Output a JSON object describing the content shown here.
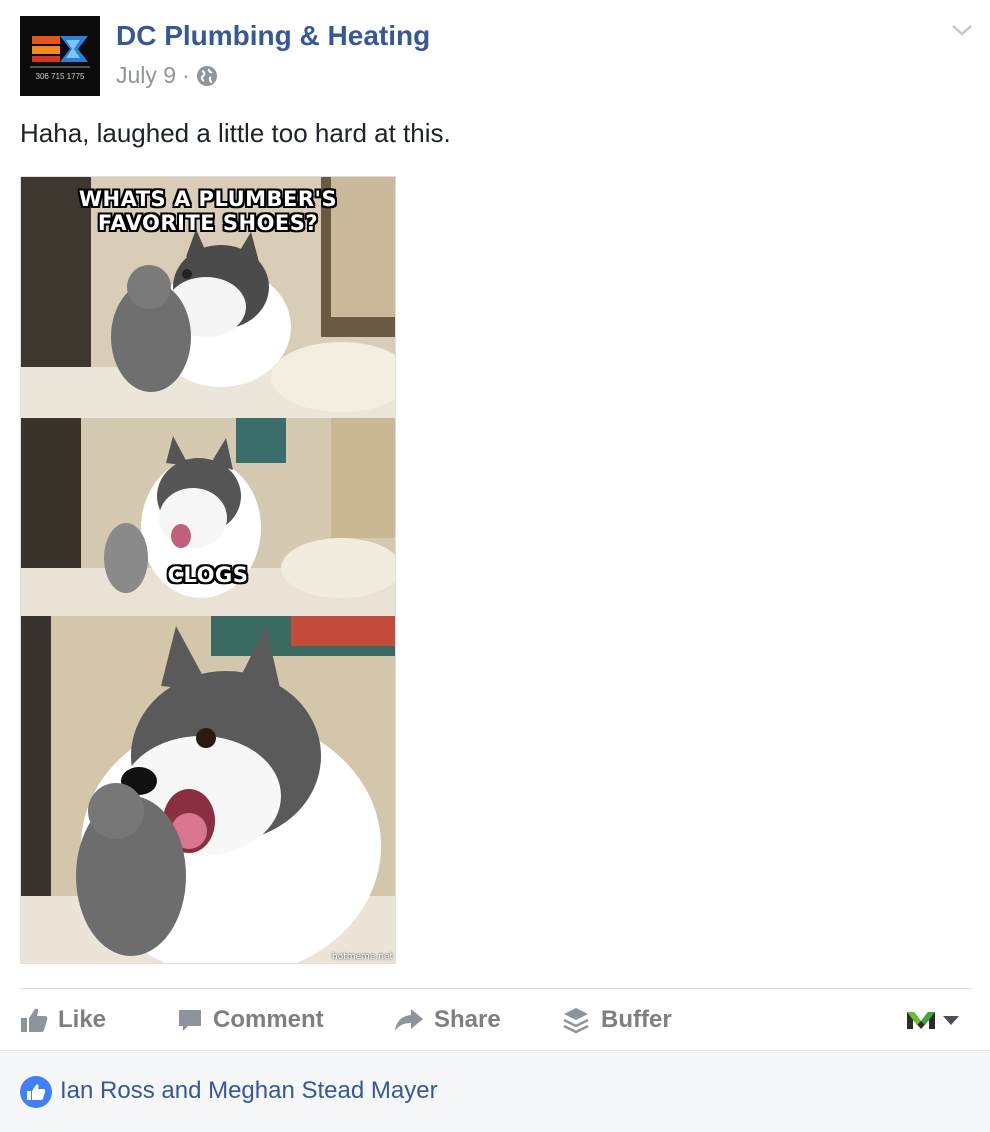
{
  "post": {
    "page_name": "DC Plumbing & Heating",
    "date": "July 9",
    "separator": "·",
    "privacy_icon": "globe-icon",
    "text": "Haha, laughed a little too hard at this.",
    "avatar": {
      "phone": "306 715 1775",
      "icon": "company-logo"
    }
  },
  "meme": {
    "caption_top_line1": "WHATS A PLUMBER'S",
    "caption_top_line2": "FAVORITE SHOES?",
    "caption_middle": "CLOGS",
    "watermark": "hotmeme.net"
  },
  "actions": {
    "like": "Like",
    "comment": "Comment",
    "share": "Share",
    "buffer": "Buffer"
  },
  "reactions": {
    "names": "Ian Ross and Meghan Stead Mayer"
  },
  "colors": {
    "link": "#365899",
    "meta": "#90949c",
    "action_text": "#7f7f7f",
    "like_blue": "#4080ff",
    "footer_bg": "#f6f7f9"
  }
}
